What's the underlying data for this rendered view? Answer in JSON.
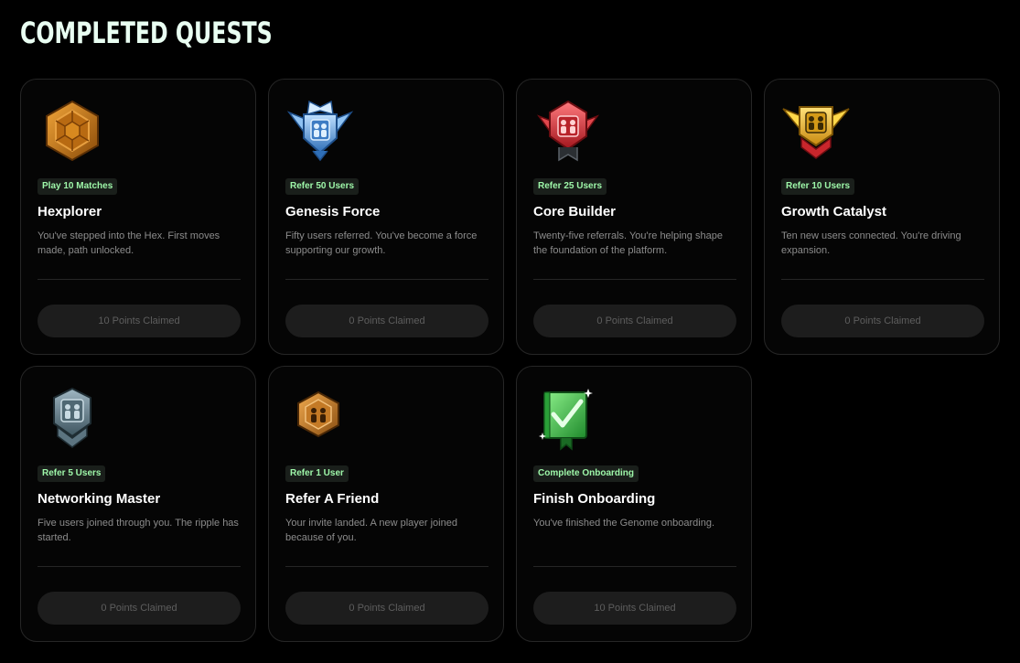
{
  "page": {
    "title": "COMPLETED QUESTS"
  },
  "quests": [
    {
      "tag": "Play 10 Matches",
      "title": "Hexplorer",
      "description": "You've stepped into the Hex. First moves made, path unlocked.",
      "button": "10 Points Claimed",
      "icon": "bronze-hexagon-badge-icon",
      "color": "#c67a16"
    },
    {
      "tag": "Refer 50 Users",
      "title": "Genesis Force",
      "description": "Fifty users referred. You've become a force supporting our growth.",
      "button": "0 Points Claimed",
      "icon": "blue-winged-crest-badge-icon",
      "color": "#4f8fd6"
    },
    {
      "tag": "Refer 25 Users",
      "title": "Core Builder",
      "description": "Twenty-five referrals. You're helping shape the foundation of the platform.",
      "button": "0 Points Claimed",
      "icon": "red-winged-crest-badge-icon",
      "color": "#d9373d"
    },
    {
      "tag": "Refer 10 Users",
      "title": "Growth Catalyst",
      "description": "Ten new users connected. You're driving expansion.",
      "button": "0 Points Claimed",
      "icon": "gold-winged-crest-badge-icon",
      "color": "#e6b21f"
    },
    {
      "tag": "Refer 5 Users",
      "title": "Networking Master",
      "description": "Five users joined through you. The ripple has started.",
      "button": "0 Points Claimed",
      "icon": "steel-shield-badge-icon",
      "color": "#6f8b99"
    },
    {
      "tag": "Refer 1 User",
      "title": "Refer A Friend",
      "description": "Your invite landed. A new player joined because of you.",
      "button": "0 Points Claimed",
      "icon": "bronze-hexagon-people-badge-icon",
      "color": "#c9822e"
    },
    {
      "tag": "Complete Onboarding",
      "title": "Finish Onboarding",
      "description": "You've finished the Genome onboarding.",
      "button": "10 Points Claimed",
      "icon": "green-checkmark-book-badge-icon",
      "color": "#3fc24c"
    }
  ]
}
